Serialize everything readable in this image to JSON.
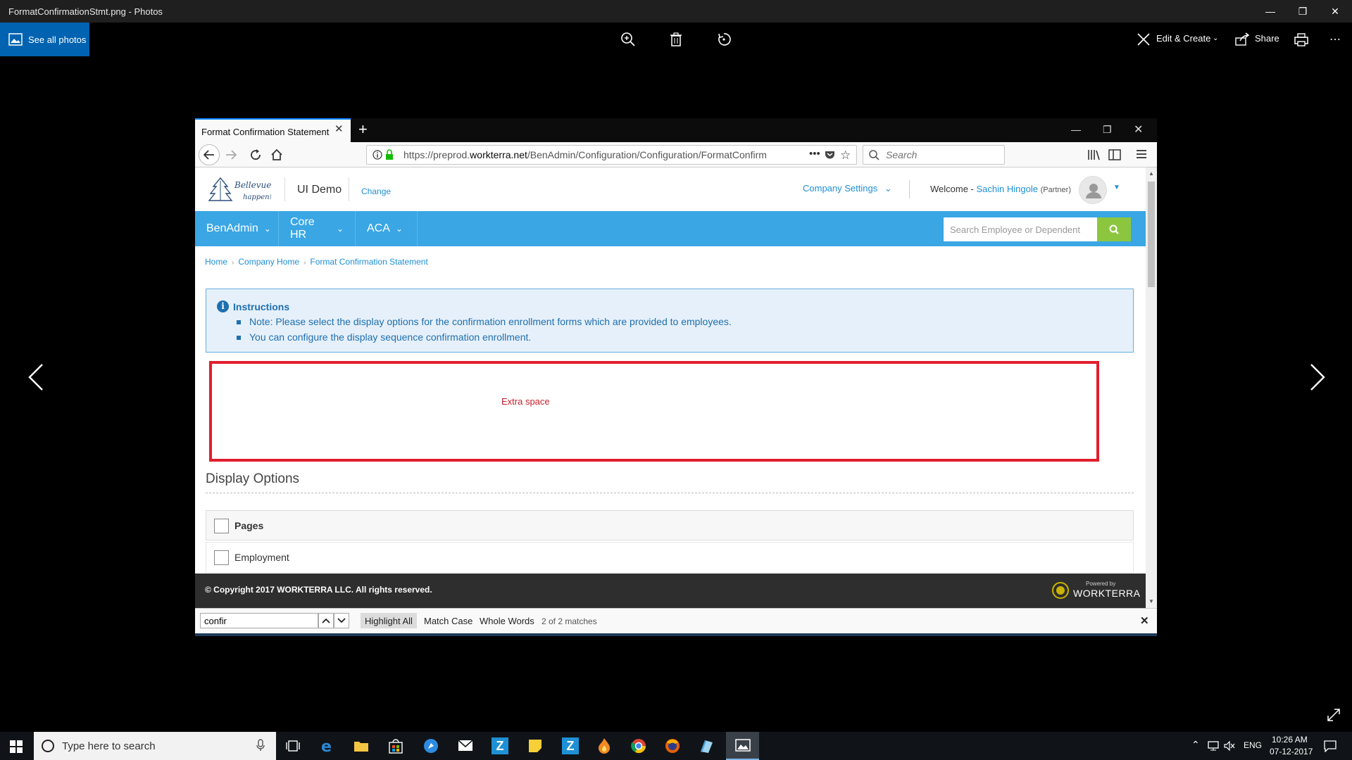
{
  "photos": {
    "window_title": "FormatConfirmationStmt.png - Photos",
    "see_all_label": "See all photos",
    "edit_create_label": "Edit & Create",
    "share_label": "Share"
  },
  "browser": {
    "tab_title": "Format Confirmation Statement",
    "url_prefix": "https://preprod.",
    "url_domain": "workterra.net",
    "url_path": "/BenAdmin/Configuration/Configuration/FormatConfirm",
    "search_placeholder": "Search"
  },
  "app": {
    "company_name": "UI Demo",
    "change_label": "Change",
    "company_settings_label": "Company Settings",
    "welcome_label": "Welcome -",
    "user_name": "Sachin Hingole",
    "user_role": "(Partner)",
    "nav": [
      {
        "label": "BenAdmin"
      },
      {
        "label": "Core HR"
      },
      {
        "label": "ACA"
      }
    ],
    "employee_search_placeholder": "Search Employee or Dependent",
    "breadcrumb": [
      "Home",
      "Company Home",
      "Format Confirmation Statement"
    ],
    "instructions": {
      "title": "Instructions",
      "items": [
        "Note: Please select the display options for the confirmation enrollment forms which are provided to employees.",
        "You can configure the display sequence confirmation enrollment."
      ]
    },
    "annotation_label": "Extra space",
    "display_options_title": "Display Options",
    "options": [
      {
        "label": "Pages",
        "checked": false
      },
      {
        "label": "Employment",
        "checked": false
      }
    ],
    "copyright": "© Copyright 2017 WORKTERRA LLC. All rights reserved.",
    "powered_by_small": "Powered by",
    "powered_by_brand": "WORKTERRA"
  },
  "findbar": {
    "query": "confir",
    "highlight_all": "Highlight All",
    "match_case": "Match Case",
    "whole_words": "Whole Words",
    "matches": "2 of 2 matches"
  },
  "taskbar": {
    "search_placeholder": "Type here to search",
    "language": "ENG",
    "time": "10:26 AM",
    "date": "07-12-2017"
  },
  "colors": {
    "nav_blue": "#3aa6e4",
    "search_green": "#8cc63f",
    "annotation_red": "#e01e2d",
    "photos_blue": "#0063b1"
  }
}
